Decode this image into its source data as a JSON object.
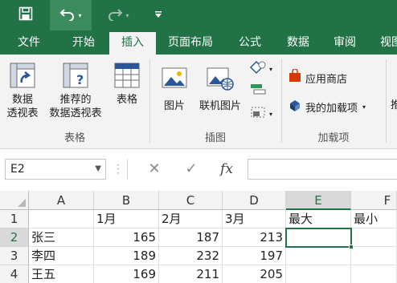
{
  "quick_access": {
    "save_icon": "save-icon",
    "undo_icon": "undo-icon",
    "redo_icon": "redo-icon",
    "customize_icon": "customize-quick-access-icon"
  },
  "tabs": [
    "文件",
    "开始",
    "插入",
    "页面布局",
    "公式",
    "数据",
    "审阅",
    "视图"
  ],
  "active_tab": "插入",
  "ribbon": {
    "tables_group": {
      "label": "表格",
      "pivot_line1": "数据",
      "pivot_line2": "透视表",
      "recommended_line1": "推荐的",
      "recommended_line2": "数据透视表",
      "table": "表格"
    },
    "illustrations_group": {
      "label": "插图",
      "pictures": "图片",
      "online_pictures": "联机图片"
    },
    "addins_group": {
      "label": "加载项",
      "store": "应用商店",
      "my_addins": "我的加载项"
    },
    "partial_next": "推"
  },
  "formula_bar": {
    "name_box": "E2",
    "cancel_symbol": "✕",
    "enter_symbol": "✓",
    "fx_symbol": "fx",
    "formula": ""
  },
  "sheet": {
    "columns": [
      "A",
      "B",
      "C",
      "D",
      "E",
      "F"
    ],
    "rows": [
      "1",
      "2",
      "3",
      "4"
    ],
    "selected_cell": "E2",
    "cells": [
      [
        "",
        "1月",
        "2月",
        "3月",
        "最大",
        "最小"
      ],
      [
        "张三",
        "165",
        "187",
        "213",
        "",
        ""
      ],
      [
        "李四",
        "189",
        "232",
        "197",
        "",
        ""
      ],
      [
        "王五",
        "169",
        "211",
        "205",
        "",
        ""
      ]
    ]
  },
  "colors": {
    "brand_green": "#217346",
    "ribbon_bg": "#f3f3f3",
    "store_red": "#d83b01",
    "addin_blue": "#2b579a"
  }
}
